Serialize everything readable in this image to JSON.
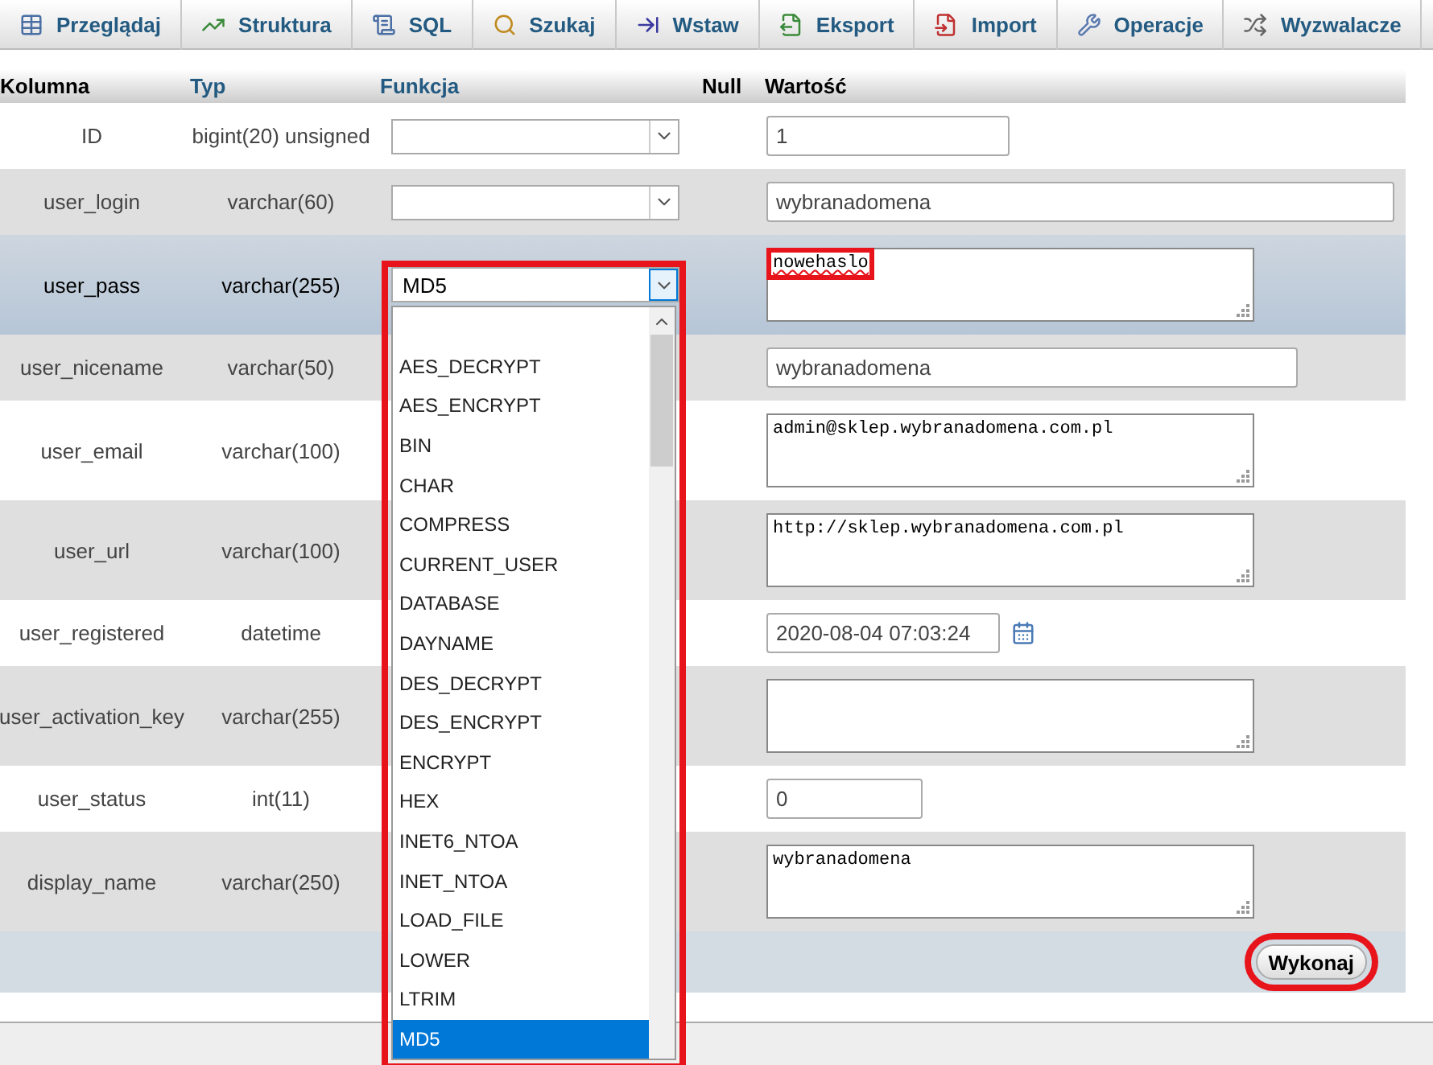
{
  "tabs": [
    {
      "label": "Przeglądaj",
      "selected": false
    },
    {
      "label": "Struktura",
      "selected": false
    },
    {
      "label": "SQL",
      "selected": false
    },
    {
      "label": "Szukaj",
      "selected": false
    },
    {
      "label": "Wstaw",
      "selected": false
    },
    {
      "label": "Eksport",
      "selected": false
    },
    {
      "label": "Import",
      "selected": false
    },
    {
      "label": "Operacje",
      "selected": false
    },
    {
      "label": "Wyzwalacze",
      "selected": false
    }
  ],
  "table": {
    "columns": [
      {
        "label": "Kolumna",
        "sortable": false
      },
      {
        "label": "Typ",
        "sortable": true
      },
      {
        "label": "Funkcja",
        "sortable": true
      },
      {
        "label": "Null",
        "sortable": false
      },
      {
        "label": "Wartość",
        "sortable": false
      }
    ],
    "rows": [
      {
        "column": "ID",
        "type": "bigint(20) unsigned",
        "highlighted": false,
        "function": {
          "open": false
        },
        "value": {
          "kind": "input",
          "text": "1"
        }
      },
      {
        "column": "user_login",
        "type": "varchar(60)",
        "highlighted": false,
        "function": {
          "open": false
        },
        "value": {
          "kind": "input",
          "text": "wybranadomena"
        }
      },
      {
        "column": "user_pass",
        "type": "varchar(255)",
        "highlighted": true,
        "function": {
          "value": "MD5",
          "open": true,
          "framed": true,
          "options": [
            {
              "selected": false
            },
            {
              "label": "AES_DECRYPT",
              "selected": false
            },
            {
              "label": "AES_ENCRYPT",
              "selected": false
            },
            {
              "label": "BIN",
              "selected": false
            },
            {
              "label": "CHAR",
              "selected": false
            },
            {
              "label": "COMPRESS",
              "selected": false
            },
            {
              "label": "CURRENT_USER",
              "selected": false
            },
            {
              "label": "DATABASE",
              "selected": false
            },
            {
              "label": "DAYNAME",
              "selected": false
            },
            {
              "label": "DES_DECRYPT",
              "selected": false
            },
            {
              "label": "DES_ENCRYPT",
              "selected": false
            },
            {
              "label": "ENCRYPT",
              "selected": false
            },
            {
              "label": "HEX",
              "selected": false
            },
            {
              "label": "INET6_NTOA",
              "selected": false
            },
            {
              "label": "INET_NTOA",
              "selected": false
            },
            {
              "label": "LOAD_FILE",
              "selected": false
            },
            {
              "label": "LOWER",
              "selected": false
            },
            {
              "label": "LTRIM",
              "selected": false
            },
            {
              "label": "MD5",
              "selected": true
            }
          ]
        },
        "value": {
          "kind": "textarea",
          "text": "nowehaslo",
          "framed": true,
          "misspelled": true
        }
      },
      {
        "column": "user_nicename",
        "type": "varchar(50)",
        "highlighted": false,
        "value": {
          "kind": "input",
          "text": "wybranadomena"
        }
      },
      {
        "column": "user_email",
        "type": "varchar(100)",
        "highlighted": false,
        "value": {
          "kind": "textarea",
          "text": "admin@sklep.wybranadomena.com.pl"
        }
      },
      {
        "column": "user_url",
        "type": "varchar(100)",
        "highlighted": false,
        "value": {
          "kind": "textarea",
          "text": "http://sklep.wybranadomena.com.pl"
        }
      },
      {
        "column": "user_registered",
        "type": "datetime",
        "highlighted": false,
        "value": {
          "kind": "datetime",
          "text": "2020-08-04 07:03:24"
        }
      },
      {
        "column": "user_activation_key",
        "type": "varchar(255)",
        "highlighted": false,
        "value": {
          "kind": "textarea"
        }
      },
      {
        "column": "user_status",
        "type": "int(11)",
        "highlighted": false,
        "value": {
          "kind": "input",
          "text": "0"
        }
      },
      {
        "column": "display_name",
        "type": "varchar(250)",
        "highlighted": false,
        "value": {
          "kind": "textarea",
          "text": "wybranadomena"
        }
      }
    ]
  },
  "submit_button": {
    "label": "Wykonaj",
    "framed": true
  }
}
